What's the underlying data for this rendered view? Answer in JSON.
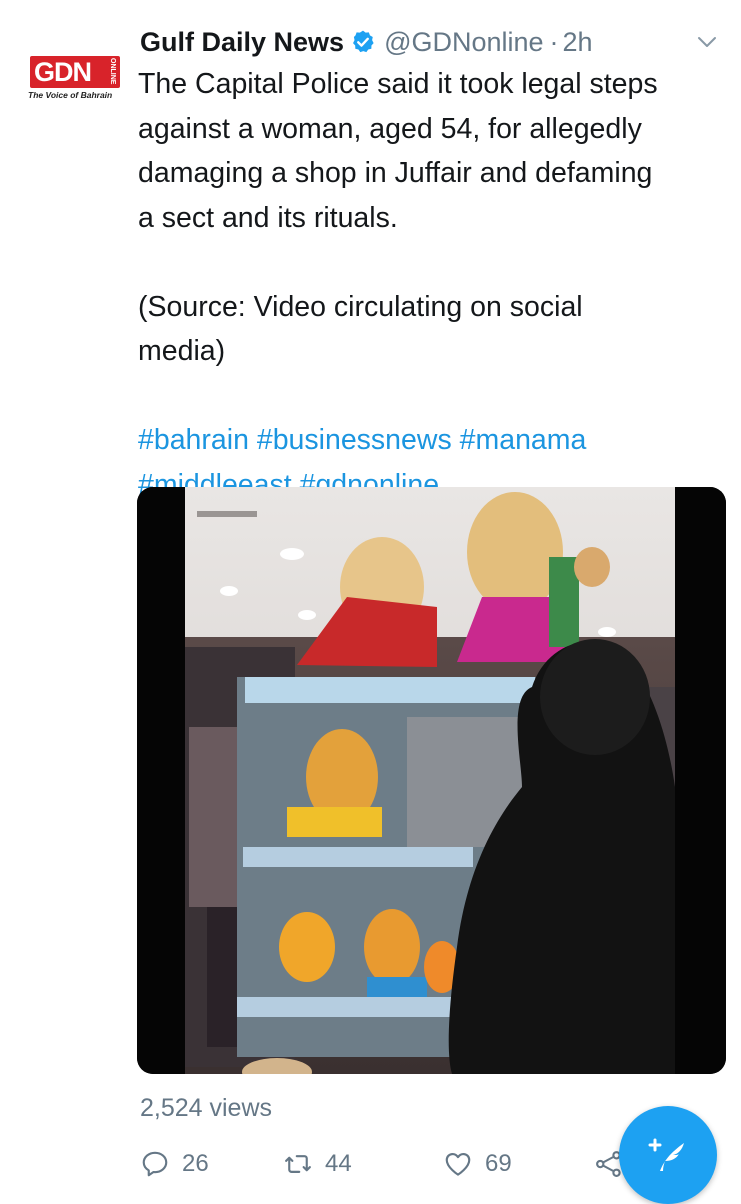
{
  "account": {
    "logo_text": "GDN",
    "logo_online": "ONLINE",
    "logo_tagline": "The Voice of Bahrain",
    "name": "Gulf Daily News",
    "handle": "@GDNonline",
    "separator": "·",
    "time": "2h",
    "verified_icon": "verified-badge-icon",
    "menu_icon": "chevron-down-icon"
  },
  "tweet": {
    "paragraph1_lines": [
      "The Capital Police said it took legal steps",
      "against a woman, aged 54, for allegedly",
      "damaging a shop in Juffair and defaming",
      "a sect and its rituals."
    ],
    "paragraph2_lines": [
      "(Source: Video circulating on social",
      "media)"
    ],
    "hashtag_lines": [
      "#bahrain #businessnews #manama",
      "#middleeast #gdnonline"
    ]
  },
  "media": {
    "type": "video-still",
    "description_icon": "video-frame"
  },
  "stats": {
    "views": "2,524 views"
  },
  "actions": [
    {
      "name": "reply",
      "icon": "reply-icon",
      "count": "26"
    },
    {
      "name": "retweet",
      "icon": "retweet-icon",
      "count": "44"
    },
    {
      "name": "like",
      "icon": "heart-icon",
      "count": "69"
    },
    {
      "name": "share",
      "icon": "share-icon",
      "count": ""
    }
  ],
  "fab": {
    "icon": "compose-tweet-icon"
  },
  "colors": {
    "brand_blue": "#1da1f2",
    "hashtag_blue": "#1b95e0",
    "muted": "#657786",
    "logo_red": "#d8232a"
  }
}
